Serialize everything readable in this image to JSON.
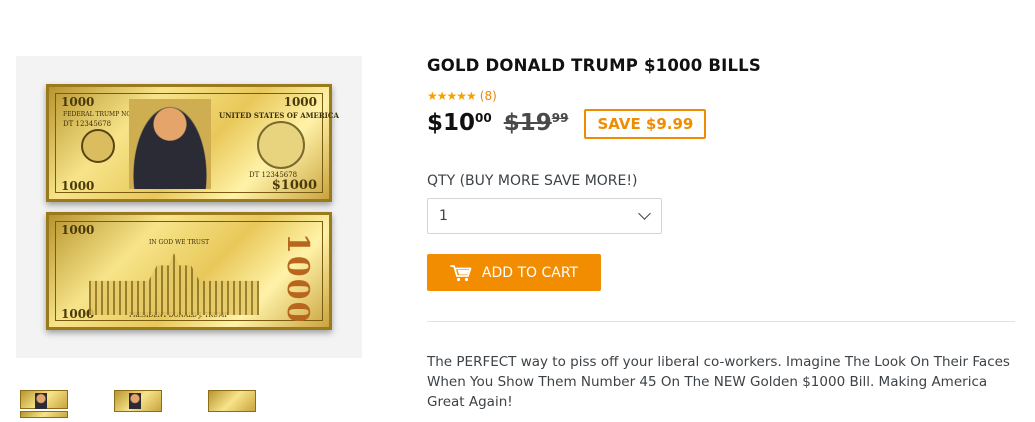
{
  "product": {
    "title": "GOLD DONALD TRUMP $1000 BILLS",
    "rating_stars": "★★★★★",
    "review_count": "(8)",
    "price": {
      "sale_main": "$10",
      "sale_cents": "00",
      "compare_main": "$19",
      "compare_cents": "99"
    },
    "save_label": "SAVE $9.99",
    "description": "The PERFECT way to piss off your liberal co-workers.  Imagine The Look On Their Faces When You Show Them Number 45 On The NEW Golden $1000 Bill.  Making America Great Again!"
  },
  "bill_front": {
    "denomination": "1000",
    "denomination_alt": "$1000",
    "note_label": "FEDERAL TRUMP NOTE",
    "country": "UNITED STATES OF AMERICA",
    "serial": "DT 12345678"
  },
  "bill_back": {
    "denomination": "1000",
    "motto": "IN GOD WE TRUST",
    "caption": "PRESIDENT DONALD J. TRUMP"
  },
  "quantity": {
    "label": "QTY (BUY MORE SAVE MORE!)",
    "selected": "1"
  },
  "cart": {
    "add_label": "ADD TO CART"
  },
  "colors": {
    "accent": "#f28c00",
    "star": "#f5a200",
    "title": "#111111",
    "text": "#3d4246"
  },
  "icons": {
    "cart": "shopping-cart-icon",
    "chevron": "chevron-down-icon"
  }
}
